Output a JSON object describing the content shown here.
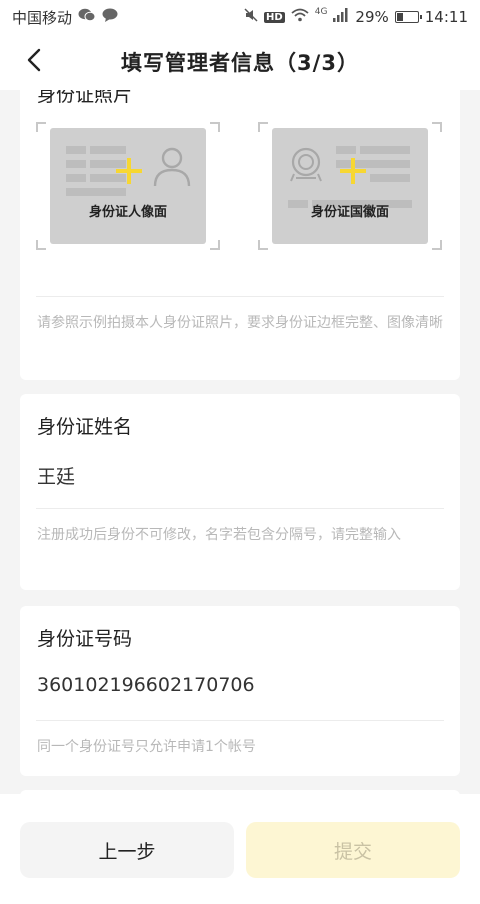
{
  "status_bar": {
    "carrier": "中国移动",
    "network_badge": "HD",
    "signal_label": "4G",
    "battery_percent": "29%",
    "battery_level": 0.29,
    "time": "14:11"
  },
  "header": {
    "title": "填写管理者信息（3/3）",
    "back_icon": "chevron-left-icon"
  },
  "id_photo_section": {
    "title": "身份证照片",
    "front_label": "身份证人像面",
    "back_label": "身份证国徽面",
    "hint": "请参照示例拍摄本人身份证照片，要求身份证边框完整、图像清晰"
  },
  "name_section": {
    "title": "身份证姓名",
    "value": "王廷",
    "hint": "注册成功后身份不可修改，名字若包含分隔号，请完整输入"
  },
  "id_number_section": {
    "title": "身份证号码",
    "value": "360102196602170706",
    "hint": "同一个身份证号只允许申请1个帐号"
  },
  "footer": {
    "prev_label": "上一步",
    "submit_label": "提交"
  },
  "colors": {
    "accent_yellow": "#f7d732",
    "submit_disabled_bg": "#fdf6d3",
    "submit_disabled_text": "#c9c2a4"
  }
}
